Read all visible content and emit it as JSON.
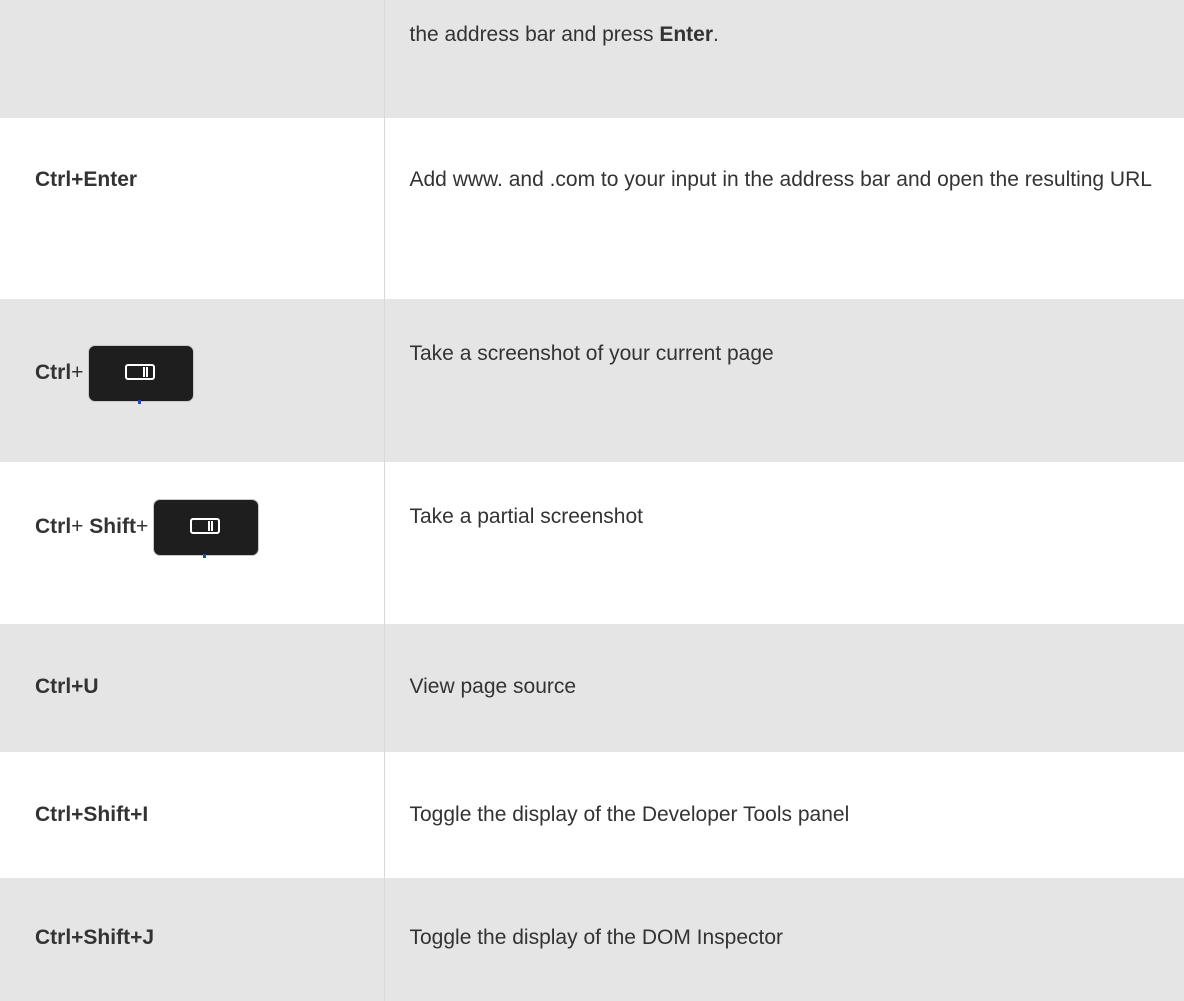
{
  "rows": [
    {
      "shortcut": "",
      "description_prefix": "the address bar and press ",
      "description_bold": "Enter",
      "description_suffix": "."
    },
    {
      "shortcut": "Ctrl+Enter",
      "description": "Add www. and .com to your input in the address bar and open the resulting URL"
    },
    {
      "shortcut_ctrl": "Ctrl",
      "shortcut_plus": "+",
      "key_icon": "screenshot-key-icon",
      "description": "Take a screenshot of your current page"
    },
    {
      "shortcut_ctrl": "Ctrl",
      "shortcut_plus1": "+",
      "shortcut_shift": "Shift",
      "shortcut_plus2": "+",
      "key_icon": "screenshot-key-icon",
      "description": "Take a partial screenshot"
    },
    {
      "shortcut": "Ctrl+U",
      "description": "View page source"
    },
    {
      "shortcut": "Ctrl+Shift+I",
      "description": "Toggle the display of the Developer Tools panel"
    },
    {
      "shortcut": "Ctrl+Shift+J",
      "description": "Toggle the display of the DOM Inspector"
    }
  ],
  "colors": {
    "shaded_row": "#e5e5e5",
    "plain_row": "#ffffff",
    "text": "#333333",
    "keycap": "#1e1e1e"
  }
}
